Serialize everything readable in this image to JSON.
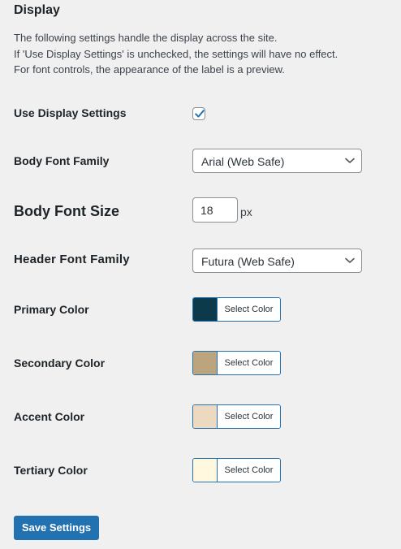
{
  "section": {
    "title": "Display",
    "description": [
      "The following settings handle the display across the site.",
      "If 'Use Display Settings' is unchecked, the settings will have no effect.",
      "For font controls, the appearance of the label is a preview."
    ]
  },
  "settings": {
    "use_display": {
      "label": "Use Display Settings",
      "checked": true
    },
    "body_font_family": {
      "label": "Body Font Family",
      "value": "Arial (Web Safe)"
    },
    "body_font_size": {
      "label": "Body Font Size",
      "value": "18",
      "unit": "px"
    },
    "header_font_family": {
      "label": "Header Font Family",
      "value": "Futura (Web Safe)"
    },
    "colors": [
      {
        "label": "Primary Color",
        "button": "Select Color",
        "color": "#0c3a4b"
      },
      {
        "label": "Secondary Color",
        "button": "Select Color",
        "color": "#bca47f"
      },
      {
        "label": "Accent Color",
        "button": "Select Color",
        "color": "#ecd9c0"
      },
      {
        "label": "Tertiary Color",
        "button": "Select Color",
        "color": "#fff7de"
      }
    ]
  },
  "actions": {
    "save_label": "Save Settings"
  },
  "theme": {
    "accent": "#2271b1"
  }
}
